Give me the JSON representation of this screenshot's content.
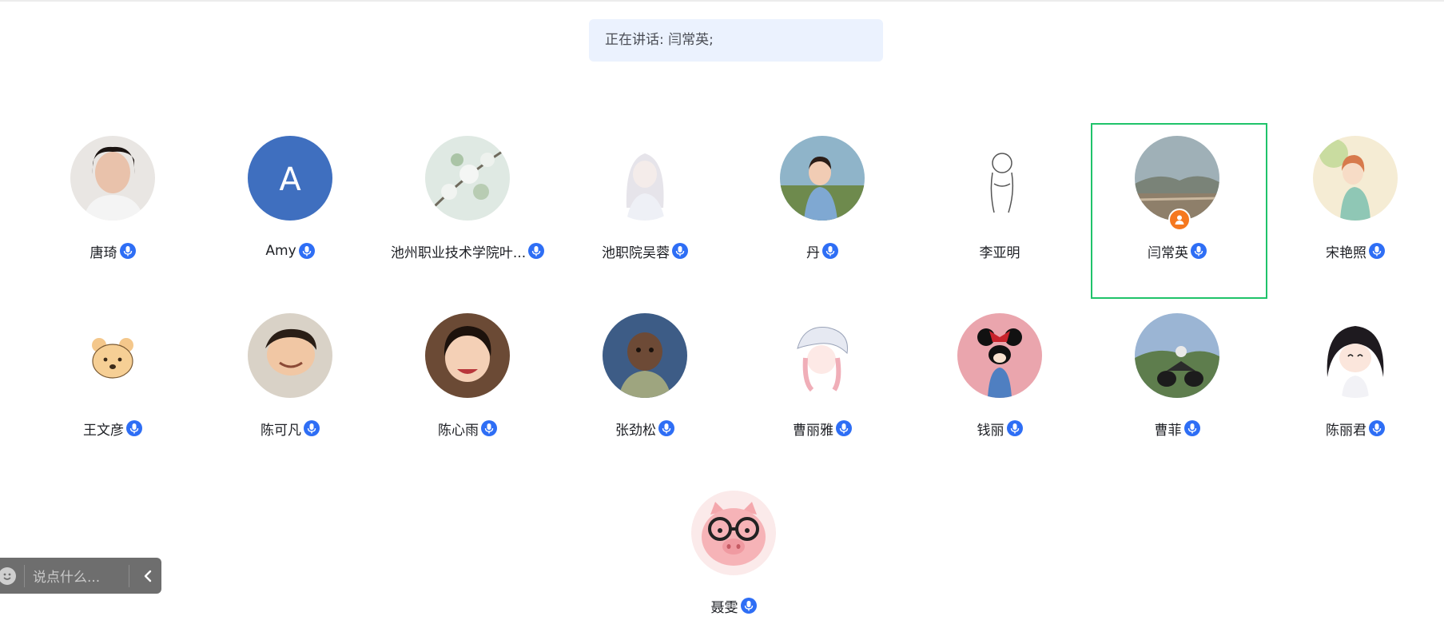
{
  "banner": {
    "text": "正在讲话: 闫常英;"
  },
  "members": [
    {
      "name": "唐琦",
      "mic": true,
      "avatar": "photo-woman-avatar"
    },
    {
      "name": "Amy",
      "mic": true,
      "avatar": "letter-avatar",
      "letter": "A"
    },
    {
      "name": "池州职业技术学院叶...",
      "mic": true,
      "avatar": "flower-branch-avatar"
    },
    {
      "name": "池职院吴蓉",
      "mic": true,
      "avatar": "anime-girl-avatar"
    },
    {
      "name": "丹",
      "mic": true,
      "avatar": "child-photo-avatar"
    },
    {
      "name": "李亚明",
      "mic": false,
      "avatar": "sketch-figure-avatar"
    },
    {
      "name": "闫常英",
      "mic": true,
      "avatar": "landscape-avatar",
      "host": true,
      "speaking": true
    },
    {
      "name": "宋艳照",
      "mic": true,
      "avatar": "illustrated-girl-avatar"
    },
    {
      "name": "王文彦",
      "mic": true,
      "avatar": "cartoon-bear-avatar"
    },
    {
      "name": "陈可凡",
      "mic": true,
      "avatar": "boy-photo-avatar"
    },
    {
      "name": "陈心雨",
      "mic": true,
      "avatar": "girl-photo-avatar"
    },
    {
      "name": "张劲松",
      "mic": true,
      "avatar": "baby-photo-avatar"
    },
    {
      "name": "曹丽雅",
      "mic": true,
      "avatar": "pink-hair-girl-avatar"
    },
    {
      "name": "钱丽",
      "mic": true,
      "avatar": "minnie-mouse-avatar"
    },
    {
      "name": "曹菲",
      "mic": true,
      "avatar": "motorcycle-photo-avatar"
    },
    {
      "name": "陈丽君",
      "mic": true,
      "avatar": "chibi-girl-avatar"
    },
    {
      "name": "聂雯",
      "mic": true,
      "avatar": "pig-glasses-avatar"
    }
  ],
  "chat": {
    "placeholder": "说点什么..."
  },
  "colors": {
    "mic_blue": "#2e6ef5",
    "active_green": "#1fc36a",
    "host_orange": "#f5781f",
    "banner_bg": "#ebf2fe"
  },
  "icons": {
    "emoji": "smile-icon",
    "collapse": "chevron-left-icon",
    "mic": "mic-icon",
    "host": "person-icon"
  }
}
